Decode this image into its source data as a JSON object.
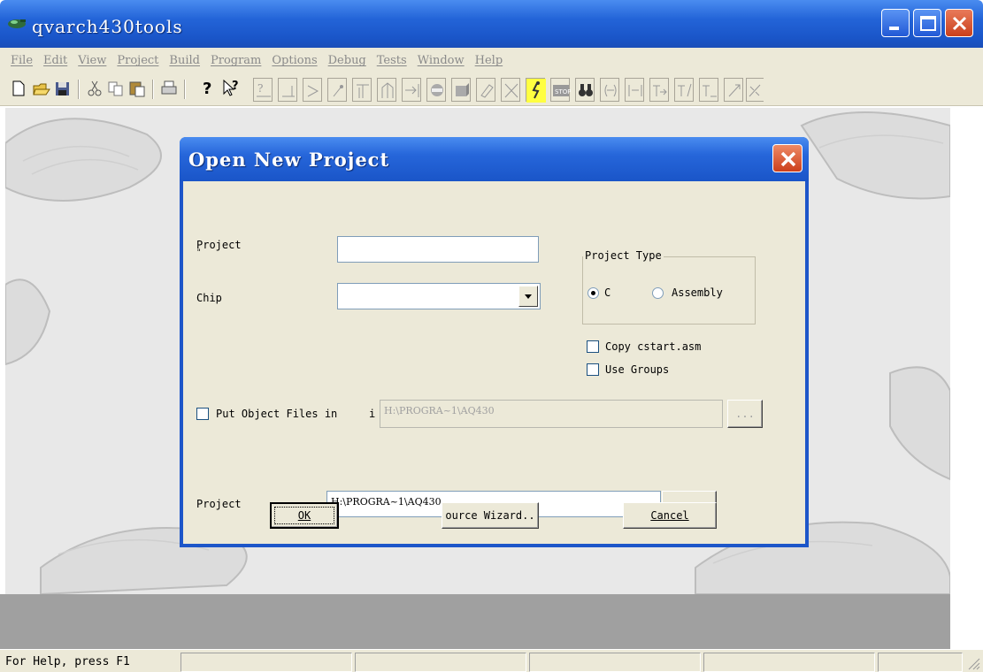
{
  "app": {
    "title": "qvarch430tools",
    "menu": [
      "File",
      "Edit",
      "View",
      "Project",
      "Build",
      "Program",
      "Options",
      "Debug",
      "Tests",
      "Window",
      "Help"
    ],
    "status_text": "For Help, press F1"
  },
  "dialog": {
    "title": "Open New Project",
    "project_name_label": "Project",
    "project_name_value": "",
    "chip_label": "Chip",
    "chip_value": "",
    "project_type_label": "Project Type",
    "radio_c_label": "C",
    "radio_assembly_label": "Assembly",
    "radio_selected": "C",
    "copy_cstart_label": "Copy cstart.asm",
    "copy_cstart_checked": false,
    "use_groups_label": "Use Groups",
    "use_groups_checked": false,
    "put_object_label": "Put Object Files in ",
    "put_object_checked": false,
    "object_dir_value": "H:\\PROGRA~1\\AQ430",
    "browse_object_label": "...",
    "project_dir_label": "Project",
    "project_dir_value": "H:\\PROGRA~1\\AQ430",
    "browse_project_label": "...",
    "ok_label": "OK",
    "wizard_label": "ource Wizard..",
    "cancel_label": "Cancel"
  }
}
